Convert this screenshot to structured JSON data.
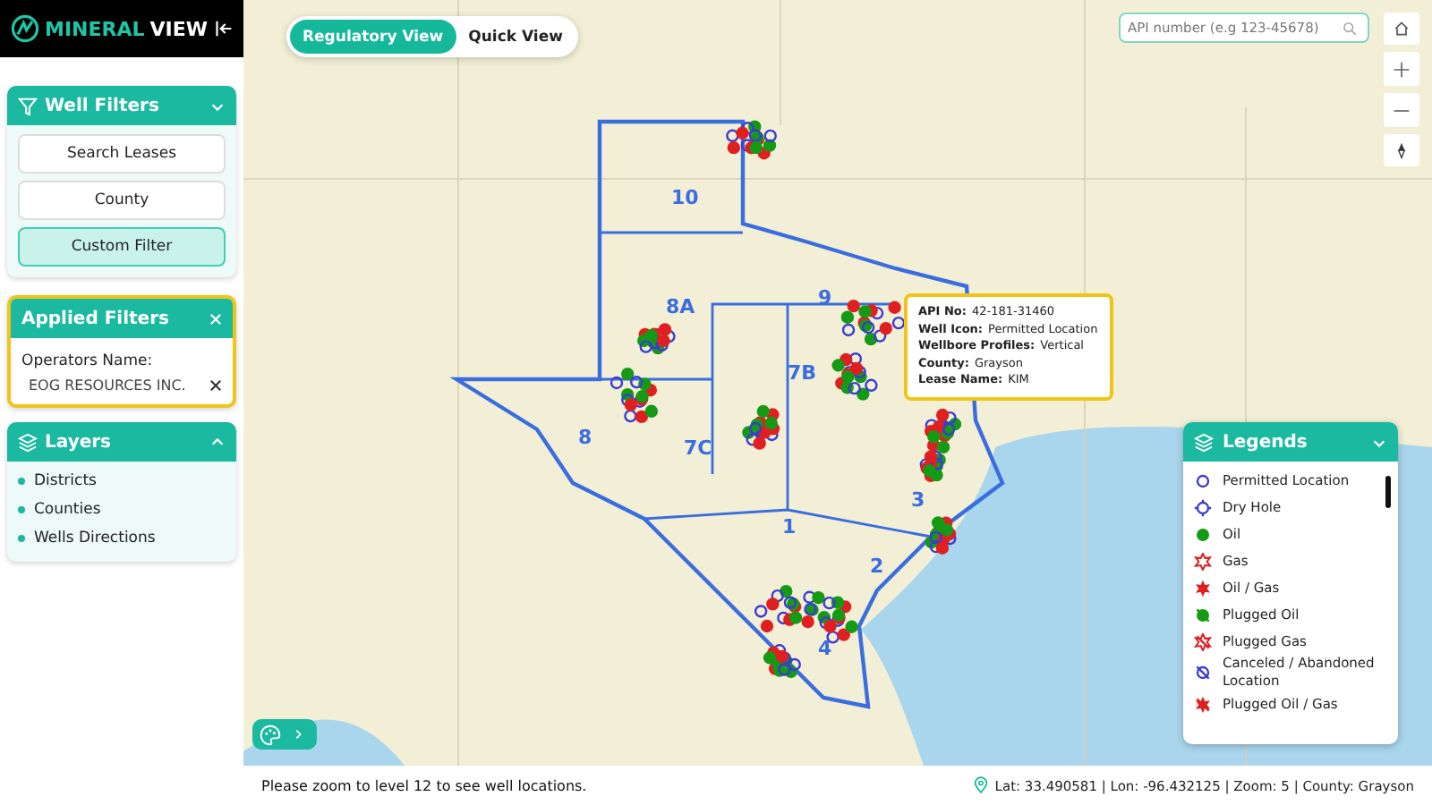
{
  "brand": {
    "name_part_1": "MINERAL",
    "name_part_2": "VIEW"
  },
  "well_filters": {
    "title": "Well Filters",
    "expanded": true,
    "buttons": [
      {
        "label": "Search Leases",
        "selected": false
      },
      {
        "label": "County",
        "selected": false
      },
      {
        "label": "Custom Filter",
        "selected": true
      }
    ]
  },
  "applied_filters": {
    "title": "Applied Filters",
    "filters": [
      {
        "label": "Operators Name:",
        "value": "EOG RESOURCES INC."
      }
    ]
  },
  "layers": {
    "title": "Layers",
    "expanded": true,
    "items": [
      "Districts",
      "Counties",
      "Wells Directions"
    ]
  },
  "view_toggle": [
    {
      "label": "Regulatory View",
      "selected": true
    },
    {
      "label": "Quick View",
      "selected": false
    }
  ],
  "search": {
    "placeholder": "API number (e.g 123-45678)"
  },
  "map": {
    "district_labels": [
      "10",
      "8A",
      "9",
      "7B",
      "8",
      "7C",
      "1",
      "2",
      "3",
      "4"
    ]
  },
  "tooltip": [
    {
      "label": "API No:",
      "value": "42-181-31460"
    },
    {
      "label": "Well Icon:",
      "value": "Permitted Location"
    },
    {
      "label": "Wellbore Profiles:",
      "value": "Vertical"
    },
    {
      "label": "County:",
      "value": "Grayson"
    },
    {
      "label": "Lease Name:",
      "value": "KIM"
    }
  ],
  "legends": {
    "title": "Legends",
    "expanded": true,
    "items": [
      {
        "label": "Permitted Location",
        "kind": "circle",
        "color": "#3b3bd6"
      },
      {
        "label": "Dry Hole",
        "kind": "dryhole",
        "color": "#3b3bd6"
      },
      {
        "label": "Oil",
        "kind": "dot",
        "color": "#159a15"
      },
      {
        "label": "Gas",
        "kind": "star",
        "color": "#e02020"
      },
      {
        "label": "Oil / Gas",
        "kind": "starfill",
        "color": "#e02020"
      },
      {
        "label": "Plugged Oil",
        "kind": "dotslash",
        "color": "#159a15"
      },
      {
        "label": "Plugged Gas",
        "kind": "starslash",
        "color": "#e02020"
      },
      {
        "label": "Canceled / Abandoned Location",
        "kind": "circleslash",
        "color": "#3b3bd6"
      },
      {
        "label": "Plugged Oil / Gas",
        "kind": "starfillslash",
        "color": "#e02020"
      }
    ]
  },
  "status_bar": {
    "message": "Please zoom to level 12 to see well locations.",
    "location": "Lat: 33.490581 | Lon: -96.432125 | Zoom: 5 | County: Grayson"
  }
}
